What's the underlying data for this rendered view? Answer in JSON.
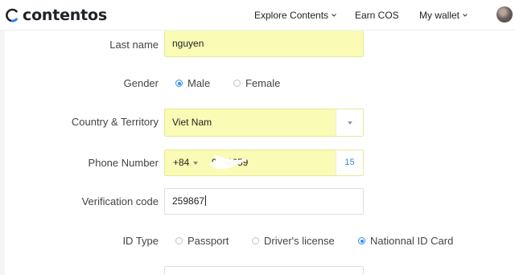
{
  "header": {
    "logo_text": "contentos",
    "nav": [
      {
        "label": "Explore Contents",
        "has_dropdown": true
      },
      {
        "label": "Earn COS",
        "has_dropdown": false
      },
      {
        "label": "My wallet",
        "has_dropdown": true
      }
    ],
    "brand_color": "#1e2328",
    "logo_accent": "#2f7cf6"
  },
  "form": {
    "last_name": {
      "label": "Last name",
      "value": "nguyen"
    },
    "gender": {
      "label": "Gender",
      "options": [
        "Male",
        "Female"
      ],
      "selected": "Male"
    },
    "country": {
      "label": "Country & Territory",
      "value": "Viet Nam"
    },
    "phone": {
      "label": "Phone Number",
      "prefix": "+84",
      "value": "9···6659",
      "code_label": "15"
    },
    "verification": {
      "label": "Verification code",
      "value": "259867"
    },
    "id_type": {
      "label": "ID Type",
      "options": [
        "Passport",
        "Driver's license",
        "Nationnal ID Card"
      ],
      "selected": "Nationnal ID Card"
    }
  },
  "colors": {
    "autofill_yellow": "#fafbb4",
    "radio_blue": "#2d8cf0"
  }
}
